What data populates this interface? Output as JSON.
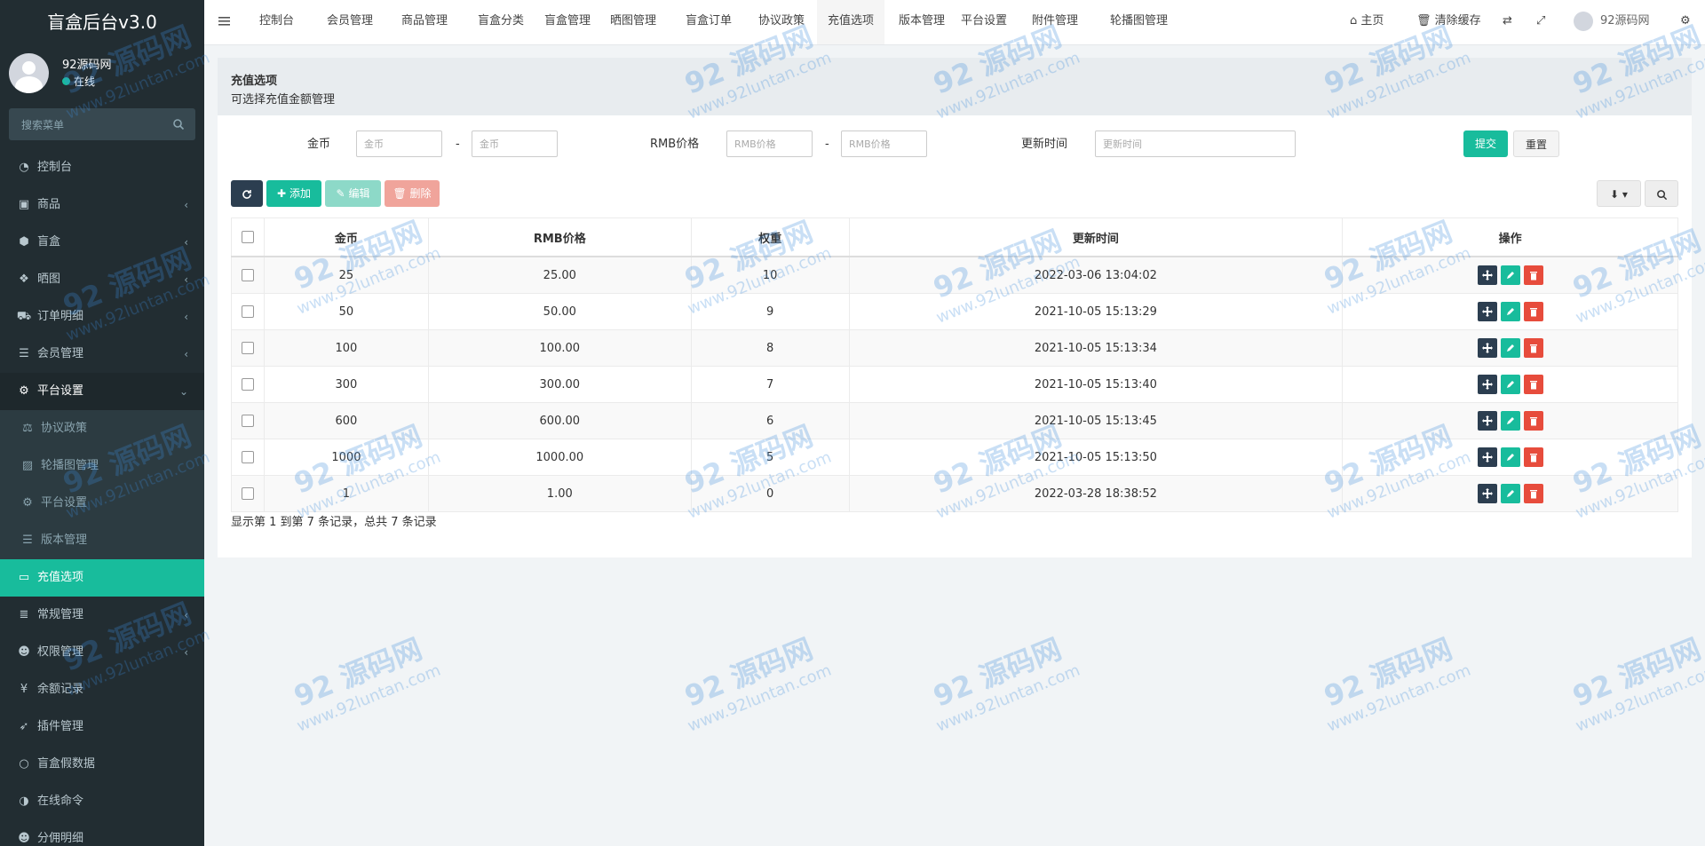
{
  "sidebar": {
    "logo": "盲盒后台v3.0",
    "user_name": "92源码网",
    "user_status": "在线",
    "search_placeholder": "搜索菜单",
    "items": [
      {
        "label": "控制台",
        "icon": "dashboard-icon",
        "chev": ""
      },
      {
        "label": "商品",
        "icon": "bag-icon",
        "chev": "‹"
      },
      {
        "label": "盲盒",
        "icon": "cube-icon",
        "chev": "‹"
      },
      {
        "label": "晒图",
        "icon": "dropbox-icon",
        "chev": "‹"
      },
      {
        "label": "订单明细",
        "icon": "cart-icon",
        "chev": "‹"
      },
      {
        "label": "会员管理",
        "icon": "list-icon",
        "chev": "‹"
      },
      {
        "label": "平台设置",
        "icon": "gear-icon",
        "chev": "⌄"
      },
      {
        "label": "协议政策",
        "icon": "scale-icon",
        "chev": ""
      },
      {
        "label": "轮播图管理",
        "icon": "image-icon",
        "chev": ""
      },
      {
        "label": "平台设置",
        "icon": "gear-icon",
        "chev": ""
      },
      {
        "label": "版本管理",
        "icon": "list-icon",
        "chev": ""
      },
      {
        "label": "充值选项",
        "icon": "card-icon",
        "chev": ""
      },
      {
        "label": "常规管理",
        "icon": "database-icon",
        "chev": "‹"
      },
      {
        "label": "权限管理",
        "icon": "users-icon",
        "chev": "‹"
      },
      {
        "label": "余额记录",
        "icon": "yen-icon",
        "chev": ""
      },
      {
        "label": "插件管理",
        "icon": "rocket-icon",
        "chev": ""
      },
      {
        "label": "盲盒假数据",
        "icon": "circle-icon",
        "chev": ""
      },
      {
        "label": "在线命令",
        "icon": "half-circle-icon",
        "chev": ""
      },
      {
        "label": "分佣明细",
        "icon": "users-icon",
        "chev": ""
      }
    ]
  },
  "topnav": {
    "items": [
      "控制台",
      "会员管理",
      "商品管理",
      "盲盒分类",
      "盲盒管理",
      "晒图管理",
      "盲盒订单",
      "协议政策",
      "充值选项",
      "版本管理",
      "平台设置",
      "附件管理",
      "轮播图管理"
    ],
    "active": "充值选项",
    "home": "主页",
    "clear_cache": "清除缓存",
    "user": "92源码网"
  },
  "panel": {
    "title": "充值选项",
    "desc": "可选择充值金额管理"
  },
  "filters": {
    "coins_label": "金币",
    "coins_ph": "金币",
    "rmb_label": "RMB价格",
    "rmb_ph": "RMB价格",
    "time_label": "更新时间",
    "time_ph": "更新时间",
    "dash": "-",
    "submit": "提交",
    "reset": "重置"
  },
  "toolbar": {
    "add": "添加",
    "edit": "编辑",
    "delete": "删除"
  },
  "table": {
    "headers": [
      "金币",
      "RMB价格",
      "权重",
      "更新时间",
      "操作"
    ],
    "rows": [
      [
        "25",
        "25.00",
        "10",
        "2022-03-06 13:04:02"
      ],
      [
        "50",
        "50.00",
        "9",
        "2021-10-05 15:13:29"
      ],
      [
        "100",
        "100.00",
        "8",
        "2021-10-05 15:13:34"
      ],
      [
        "300",
        "300.00",
        "7",
        "2021-10-05 15:13:40"
      ],
      [
        "600",
        "600.00",
        "6",
        "2021-10-05 15:13:45"
      ],
      [
        "1000",
        "1000.00",
        "5",
        "2021-10-05 15:13:50"
      ],
      [
        "1",
        "1.00",
        "0",
        "2022-03-28 18:38:52"
      ]
    ]
  },
  "footer": "显示第 1 到第 7 条记录，总共 7 条记录",
  "watermark": {
    "a": "92 源码网",
    "b": "www.92luntan.com"
  }
}
